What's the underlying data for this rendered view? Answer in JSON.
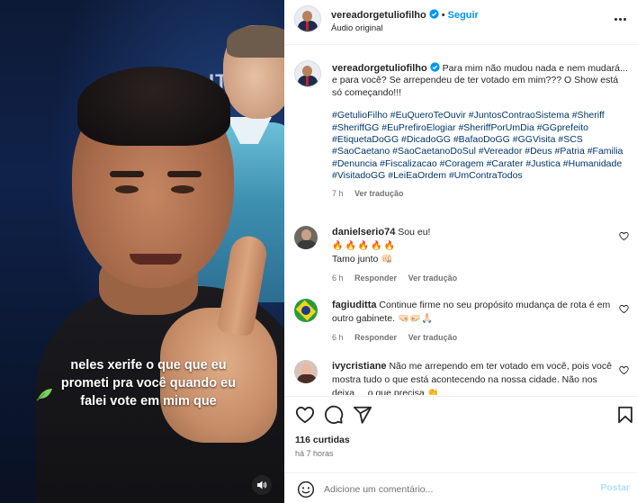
{
  "post": {
    "author": "vereadorgetuliofilho",
    "follow_label": "Seguir",
    "audio": "Áudio original",
    "caption_text": "Para mim não mudou nada e nem mudará... e para você? Se arrependeu de ter votado em mim??? O Show está só começando!!!",
    "hashtags": "#GetulioFilho #EuQueroTeOuvir #JuntosContraoSistema #Sheriff #SheriffGG #EuPrefiroElogiar #SheriffPorUmDia #GGprefeito #EtiquetaDoGG #DicadoGG #BafaoDoGG #GGVisita #SCS #SaoCaetano #SaoCaetanoDoSul #Vereador #Deus #Patria #Familia #Denuncia #Fiscalizacao #Coragem #Carater #Justica #Humanidade #VisitadoGG #LeiEaOrdem #UmContraTodos",
    "caption_time": "7 h",
    "see_translation": "Ver tradução",
    "likes": "116 curtidas",
    "time_ago": "há 7 horas"
  },
  "video": {
    "sign_text": "ITT",
    "subtitle_lines": [
      "neles xerife o que que eu",
      "prometi pra você quando eu",
      "falei vote em mim que"
    ]
  },
  "comments": [
    {
      "user": "danielserio74",
      "text": "Sou eu!",
      "emoji_line": "🔥🔥🔥🔥🔥",
      "extra_line": "Tamo junto 👊🏻",
      "time": "6 h",
      "reply": "Responder",
      "translate": "Ver tradução"
    },
    {
      "user": "fagiuditta",
      "text": "Continue firme no seu propósito mudança de rota é em outro gabinete. 🤜🏻🤛🏻🙏🏻",
      "time": "6 h",
      "reply": "Responder",
      "translate": "Ver tradução"
    },
    {
      "user": "ivycristiane",
      "text": "Não me arrependo em ter votado em você, pois você mostra tudo o que está acontecendo na nossa cidade. Não nos deixa ... o que precisa 👏",
      "time": "",
      "reply": "",
      "translate": ""
    }
  ],
  "composer": {
    "placeholder": "Adicione um comentário...",
    "post_label": "Postar"
  },
  "icons": {
    "verified": "verified-badge-icon",
    "heart": "heart-icon",
    "comment": "comment-icon",
    "share": "share-icon",
    "save": "bookmark-icon",
    "more": "more-options-icon",
    "emoji": "emoji-icon",
    "volume": "speaker-icon",
    "leaf": "leaf-icon"
  },
  "colors": {
    "link_blue": "#0095f6",
    "hashtag": "#00376b",
    "muted": "#737373",
    "post_disabled": "#b2dffc"
  }
}
